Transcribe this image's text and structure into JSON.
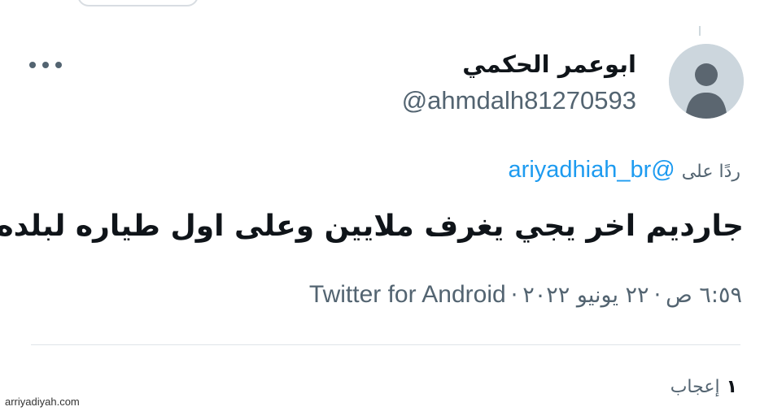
{
  "tweet": {
    "author": {
      "display_name": "ابوعمر الحكمي",
      "handle": "@ahmdalh81270593",
      "avatar_icon": "default-user-avatar-icon"
    },
    "more_icon": "more-horizontal-icon",
    "reply": {
      "prefix": "ردًا على",
      "mention": "@ariyadhiah_br"
    },
    "text": "جارديم اخر يجي يغرف ملايين وعلى اول طياره لبلده",
    "meta": {
      "time": "٦:٥٩ ص",
      "separator": "·",
      "date": "٢٢ يونيو ٢٠٢٢",
      "source": "Twitter for Android"
    },
    "likes": {
      "count": "١",
      "label": "إعجاب"
    }
  },
  "watermark": "arriyadiyah.com",
  "colors": {
    "accent_link": "#1d9bf0",
    "secondary_text": "#536471",
    "primary_text": "#0f1419",
    "avatar_bg": "#ccd6dd",
    "avatar_fg": "#5b6670"
  }
}
